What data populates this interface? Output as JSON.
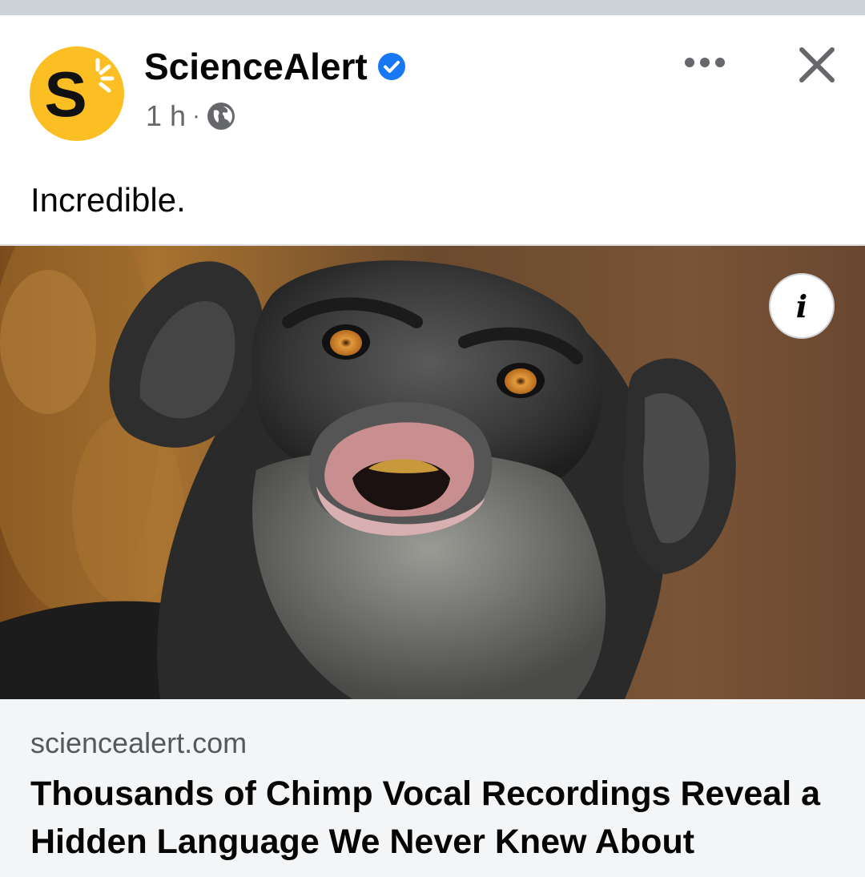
{
  "post": {
    "page_name": "ScienceAlert",
    "time": "1 h",
    "separator": "·",
    "caption": "Incredible."
  },
  "icons": {
    "avatar": "sciencealert-logo",
    "verified": "verified-badge-icon",
    "audience": "globe-icon",
    "more": "more-options-icon",
    "close": "close-icon",
    "info": "info-icon"
  },
  "colors": {
    "verified": "#1877f2",
    "logo_yellow": "#fbbf24"
  },
  "link_card": {
    "domain": "sciencealert.com",
    "headline": "Thousands of Chimp Vocal Recordings Reveal a Hidden Language We Never Knew About"
  },
  "info_button": {
    "label": "i"
  }
}
